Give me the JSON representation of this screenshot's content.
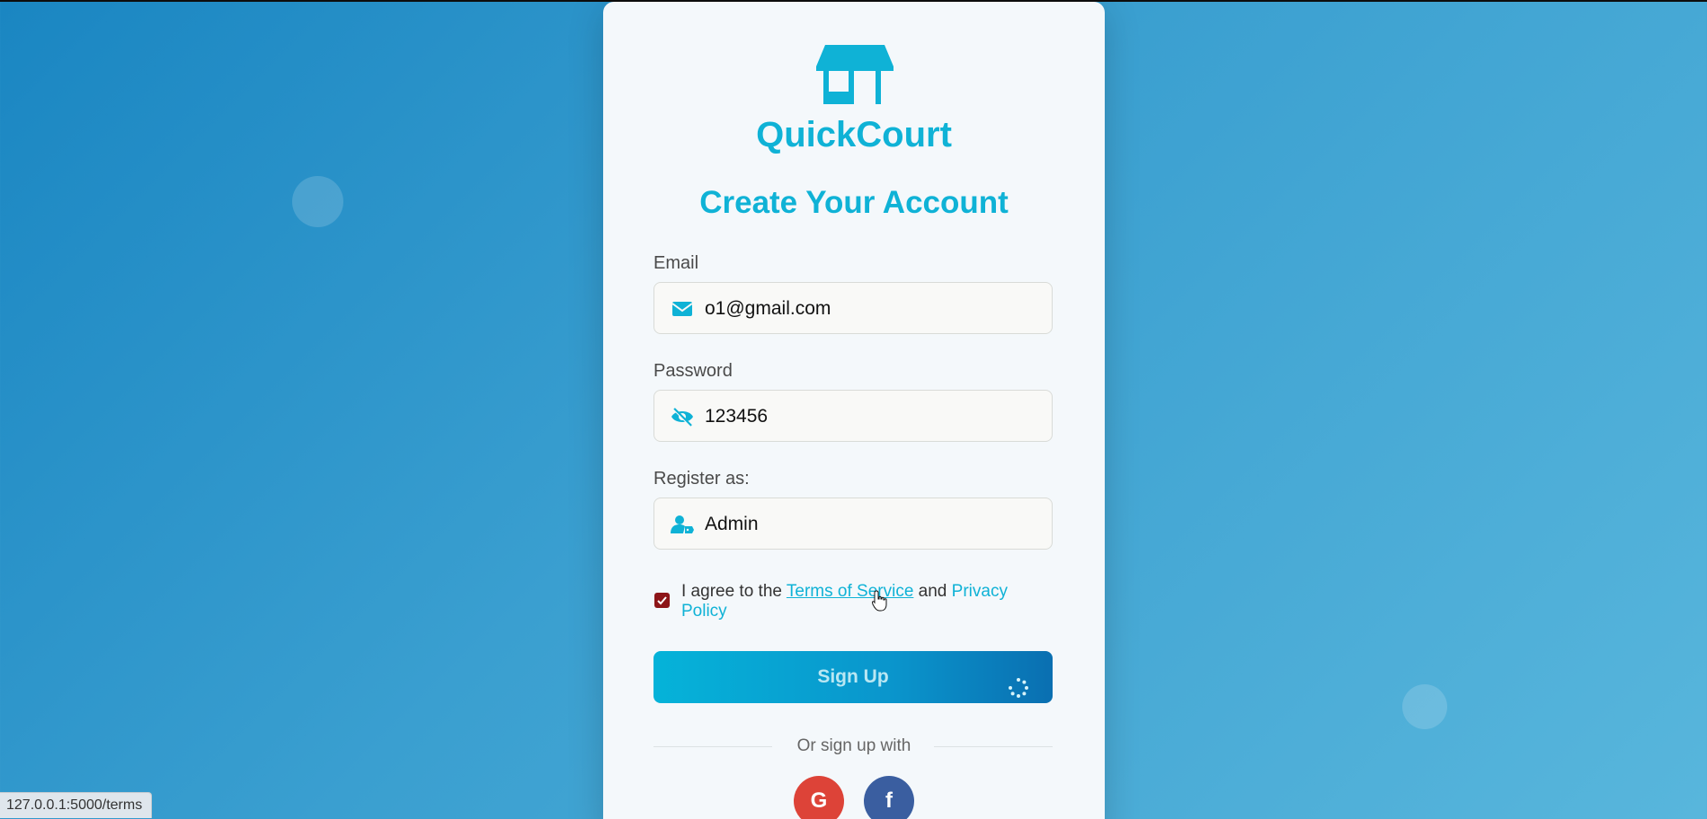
{
  "brand": {
    "name": "QuickCourt",
    "logo_icon": "store-icon",
    "color": "#0fb2d6"
  },
  "form": {
    "heading": "Create Your Account",
    "email": {
      "label": "Email",
      "value": "o1@gmail.com",
      "icon": "envelope-icon"
    },
    "password": {
      "label": "Password",
      "value": "123456",
      "icon": "eye-slash-icon"
    },
    "role": {
      "label": "Register as:",
      "value": "Admin",
      "icon": "user-tag-icon"
    },
    "terms": {
      "checked": true,
      "prefix": "I agree to the",
      "terms_link": "Terms of Service",
      "conjunction": "and",
      "privacy_link": "Privacy Policy"
    },
    "submit_label": "Sign Up",
    "submit_loading": true
  },
  "social": {
    "divider_text": "Or sign up with",
    "google_label": "G",
    "facebook_label": "f"
  },
  "status_bar": {
    "url": "127.0.0.1:5000/terms"
  },
  "colors": {
    "accent": "#0fb2d6",
    "checkbox": "#8d1518",
    "google": "#dd4338",
    "facebook": "#3a5ea0"
  }
}
